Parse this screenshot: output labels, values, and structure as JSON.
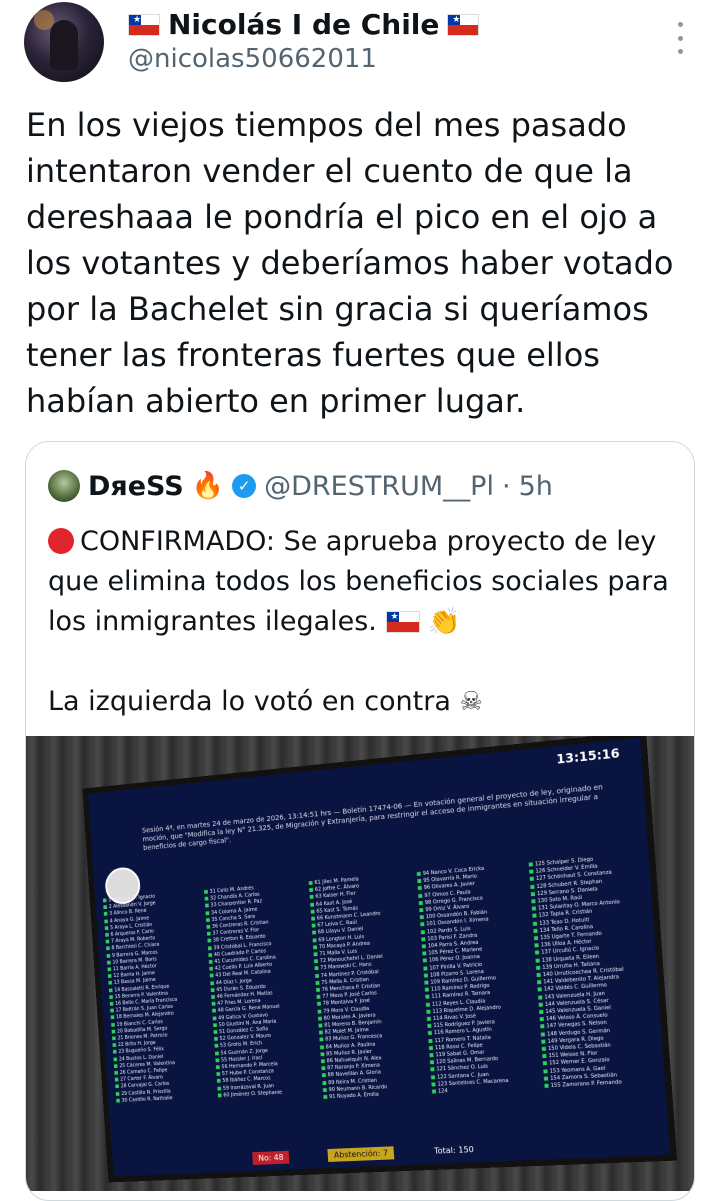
{
  "author": {
    "name": "Nicolás I de Chile",
    "handle": "@nicolas50662011"
  },
  "tweet": {
    "text": "En los viejos tiempos del mes pasado intentaron vender el cuento de que la dereshaaa le pondría el pico en el ojo a los votantes y deberíamos haber votado por la Bachelet sin gracia si queríamos tener las fronteras fuertes que ellos habían abierto en primer lugar."
  },
  "quote": {
    "name": "DяeSS",
    "handle": "@DRESTRUM__Pl",
    "separator": "·",
    "time": "5h",
    "line1": "CONFIRMADO: Se aprueba proyecto de ley que elimina todos los beneficios sociales para los inmigrantes ilegales.",
    "line2": "La izquierda lo votó en contra",
    "image": {
      "time": "13:15:16",
      "title": "Sesión 4ª, en martes 24 de marzo de 2026, 13:14:51 hrs — Boletín 17474-06 — En votación general el proyecto de ley, originado en moción, que \"Modifica la ley N° 21.325, de Migración y Extranjería, para restringir el acceso de inmigrantes en situación irregular a beneficios de cargo fiscal\".",
      "columns": [
        [
          "1 Achurra D. Ignacio",
          "2 Alessandri V. Jorge",
          "3 Alinco B. René",
          "4 Anaya G. Jaime",
          "5 Araya L. Cristián",
          "6 Arqueros F. Carlo",
          "7 Araya M. Roberto",
          "8 Barchiesi C. Chiara",
          "9 Barrera G. Marcos",
          "10 Barrera M. Boris",
          "11 Barría A. Héctor",
          "12 Barria H. Jaime",
          "13 Bassa M. Jaime",
          "14 Bassaletti R. Enrique",
          "15 Becerra P. Valentina",
          "16 Bello C. María Francisca",
          "17 Beltrán S. Juan Carlos",
          "18 Bernales M. Alejandro",
          "19 Bianchi C. Carlos",
          "20 Bobadilla M. Sergo",
          "21 Briones M. Patricio",
          "22 Brito H. Jorge",
          "23 Bugueño S. Félix",
          "24 Bustos L. Daniel",
          "25 Cáceres M. Valentina",
          "26 Camaño C. Felipe",
          "27 Carter F. Álvaro",
          "28 Carvajal G. Carlos",
          "29 Castillo N. Priscilla",
          "30 Castillo R. Nathalie"
        ],
        [
          "31 Celis M. Andrés",
          "32 Chandía A. Carlos",
          "33 Charpentier R. Paz",
          "34 Coloma Á. Jaime",
          "35 Concha S. Sara",
          "36 Contreras R. Cristian",
          "37 Contreras V. Flor",
          "38 Cretton R. Eduardo",
          "39 Cristóbal L. Francisco",
          "40 Cuadrado P. Carlos",
          "41 Cucumides C. Carolina",
          "42 Cuello P. Luis Alberto",
          "43 Del Real M. Catalina",
          "44 Díaz I. Jorge",
          "45 Durán S. Eduardo",
          "46 Fernández H. Matías",
          "47 Fries M. Lorena",
          "48 García G. René Manuel",
          "49 Gatica V. Gustavo",
          "50 Giustini N. Ana María",
          "51 González C. Sofía",
          "52 Gonzalez V. Mauro",
          "53 Grohs M. Erich",
          "54 Guzmán Z. Jorge",
          "55 Hassler J. Irací",
          "56 Hernando P. Marcela",
          "57 Hube P. Constanza",
          "58 Ibáñez C. Marcos",
          "59 Irarrázaval R. Juan",
          "60 Jiménez O. Stephanie"
        ],
        [
          "61 Jiles M. Pamela",
          "62 Joffre C. Álvaro",
          "63 Kaiser H. Flor",
          "64 Kast A. José",
          "65 Kast S. Tomás",
          "66 Kunstmann C. Leandro",
          "67 Leiva C. Raúl",
          "68 Lilayu V. Daniel",
          "69 Longton H. Luis",
          "70 Macaya P. Andrea",
          "71 Malla V. Luis",
          "72 Manouchehri L. Daniel",
          "73 Marowski C. Hans",
          "74 Martínez P. Cristóbal",
          "75 Mella A. Cristian",
          "76 Menchaca P. Cristian",
          "77 Meza P. José Carlos",
          "78 Montalva F. José",
          "79 Mora V. Claudia",
          "80 Morales A. Javiera",
          "81 Moreno B. Benjamín",
          "82 Mulet M. Jaime",
          "83 Muñoz G. Francesca",
          "84 Muñoz A. Paulina",
          "85 Muñoz R. Javier",
          "86 Nahuelquín N. Alex",
          "87 Naranjo P. Ximena",
          "88 Naveillán A. Gloria",
          "89 Neira M. Cristian",
          "90 Neumann B. Ricardo",
          "91 Nuyado A. Emilia"
        ],
        [
          "94 Ñanco V. Coca Ericka",
          "95 Olavarría R. Mario",
          "96 Olivares A. Javier",
          "97 Olmos C. Paula",
          "98 Orrego G. Francisco",
          "99 Ortiz V. Álvaro",
          "100 Ossandón B. Fabián",
          "101 Ossandón I. Ximena",
          "102 Pardo S. Luis",
          "103 Parisi F. Zandra",
          "104 Parra S. Andrea",
          "105 Pérez C. Marlene",
          "106 Pérez O. Joanna",
          "107 Pinilla V. Patricio",
          "108 Pizarro S. Lorena",
          "109 Ramírez D. Guillermo",
          "110 Ramírez P. Rodrigo",
          "111 Ramírez R. Tamara",
          "112 Reyes L. Claudia",
          "113 Riquelme D. Alejandro",
          "114 Rivas V. José",
          "115 Rodríguez P. Javiera",
          "116 Romero L. Agustín",
          "117 Romero T. Natalia",
          "118 Rossi C. Felipe",
          "119 Sabat G. Omar",
          "120 Salinas M. Bernardo",
          "121 Sánchez O. Luis",
          "122 Santana C. Juan",
          "123 Santelices C. Macarena",
          "124"
        ],
        [
          "125 Schalper S. Diego",
          "126 Schneider V. Emilia",
          "127 Schönhaut S. Constanza",
          "128 Schubert R. Stephan",
          "129 Serrano S. Daniela",
          "130 Soto M. Raúl",
          "131 Sulantay O. Marco Antonio",
          "132 Tapia R. Cristián",
          "133 Teao D. Hotuiti",
          "134 Tello R. Carolina",
          "135 Ugarte T. Fernando",
          "136 Ulloa A. Héctor",
          "137 Urcullú C. Ignacio",
          "138 Urqueta R. Eileen",
          "139 Urrutia H. Tatiana",
          "140 Urruticoechea R. Cristóbal",
          "141 Valdebenito T. Alejandra",
          "142 Valdés C. Guillermo",
          "143 Valenzuela H. Juan",
          "144 Valenzuela S. César",
          "145 Valenzuela S. Daniel",
          "146 Veloso Á. Consuelo",
          "147 Venegas S. Nelson",
          "148 Verdugo S. Germán",
          "149 Vergara R. Diego",
          "150 Videla C. Sebastián",
          "151 Weisse N. Flor",
          "152 Werner E. Gonzalo",
          "153 Yeomans A. Gael",
          "154 Zamora S. Sebastián",
          "155 Zamorano P. Fernando"
        ]
      ],
      "footer": {
        "no": "No: 48",
        "abstention": "Abstención: 7",
        "total": "Total: 150"
      }
    }
  }
}
